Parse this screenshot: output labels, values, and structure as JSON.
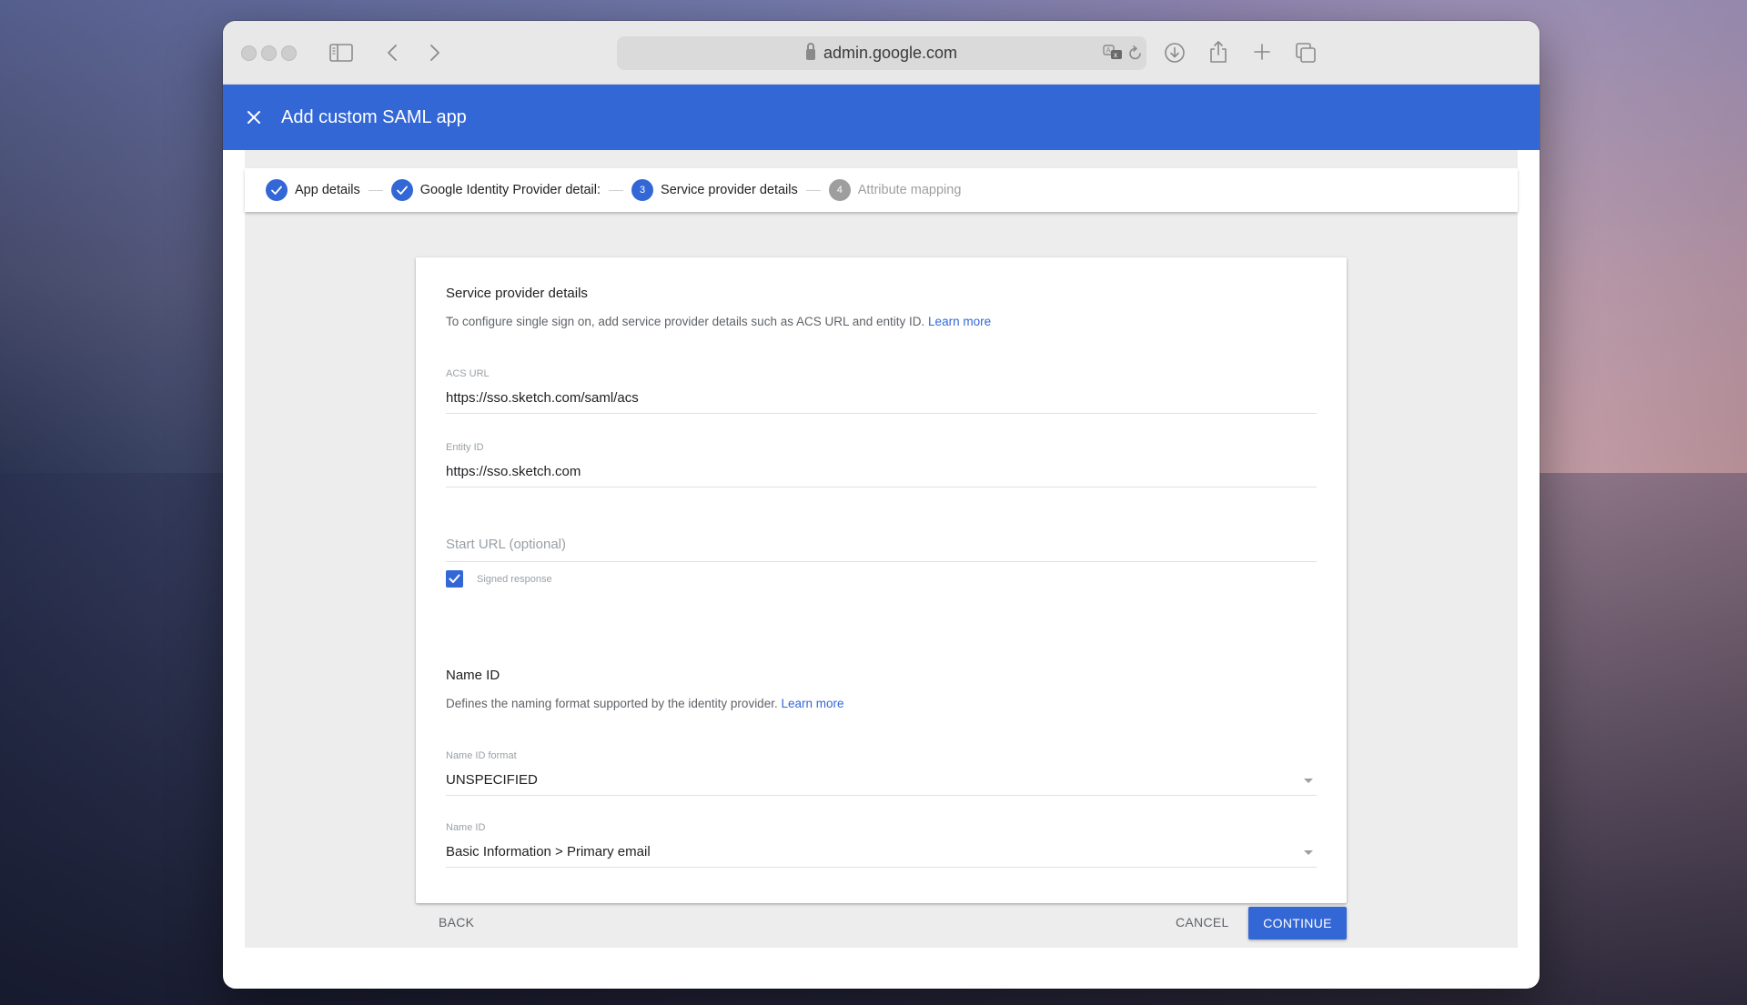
{
  "browser": {
    "address": "admin.google.com",
    "icons": [
      "sidebar-icon",
      "back-icon",
      "forward-icon",
      "lock-icon",
      "translate-icon",
      "reload-icon",
      "download-icon",
      "share-icon",
      "new-tab-icon",
      "tabs-overview-icon"
    ]
  },
  "header": {
    "title": "Add custom SAML app",
    "close_icon": "close-icon"
  },
  "stepper": {
    "steps": [
      {
        "label": "App details",
        "state": "completed",
        "marker": "✓"
      },
      {
        "label": "Google Identity Provider detail:",
        "state": "completed",
        "marker": "✓"
      },
      {
        "label": "Service provider details",
        "state": "active",
        "marker": "3"
      },
      {
        "label": "Attribute mapping",
        "state": "pending",
        "marker": "4"
      }
    ]
  },
  "form": {
    "section1": {
      "title": "Service provider details",
      "description": "To configure single sign on, add service provider details such as ACS URL and entity ID.",
      "learn_more": "Learn more"
    },
    "acs_url": {
      "label": "ACS URL",
      "value": "https://sso.sketch.com/saml/acs"
    },
    "entity_id": {
      "label": "Entity ID",
      "value": "https://sso.sketch.com"
    },
    "start_url": {
      "placeholder": "Start URL (optional)",
      "value": ""
    },
    "signed_response": {
      "label": "Signed response",
      "checked": true
    },
    "section2": {
      "title": "Name ID",
      "description": "Defines the naming format supported by the identity provider.",
      "learn_more": "Learn more"
    },
    "name_id_format": {
      "label": "Name ID format",
      "value": "UNSPECIFIED"
    },
    "name_id": {
      "label": "Name ID",
      "value": "Basic Information > Primary email"
    }
  },
  "actions": {
    "back": "BACK",
    "cancel": "CANCEL",
    "continue": "CONTINUE"
  },
  "colors": {
    "accent": "#3367d6",
    "pending_step": "#9e9e9e",
    "content_bg": "#ededed"
  }
}
